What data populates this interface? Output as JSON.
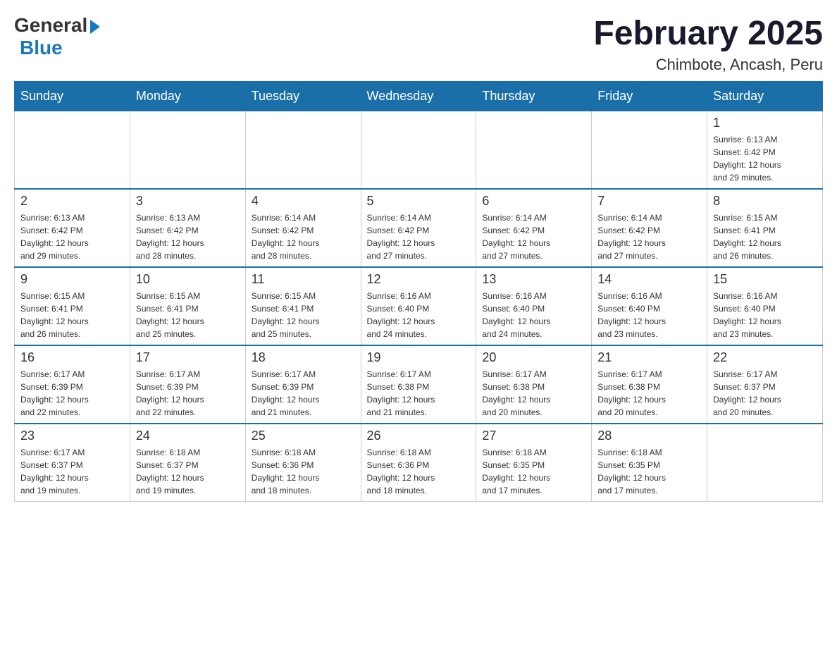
{
  "header": {
    "logo": {
      "general": "General",
      "blue": "Blue"
    },
    "title": "February 2025",
    "subtitle": "Chimbote, Ancash, Peru"
  },
  "days_of_week": [
    "Sunday",
    "Monday",
    "Tuesday",
    "Wednesday",
    "Thursday",
    "Friday",
    "Saturday"
  ],
  "weeks": [
    [
      {
        "day": "",
        "info": ""
      },
      {
        "day": "",
        "info": ""
      },
      {
        "day": "",
        "info": ""
      },
      {
        "day": "",
        "info": ""
      },
      {
        "day": "",
        "info": ""
      },
      {
        "day": "",
        "info": ""
      },
      {
        "day": "1",
        "info": "Sunrise: 6:13 AM\nSunset: 6:42 PM\nDaylight: 12 hours\nand 29 minutes."
      }
    ],
    [
      {
        "day": "2",
        "info": "Sunrise: 6:13 AM\nSunset: 6:42 PM\nDaylight: 12 hours\nand 29 minutes."
      },
      {
        "day": "3",
        "info": "Sunrise: 6:13 AM\nSunset: 6:42 PM\nDaylight: 12 hours\nand 28 minutes."
      },
      {
        "day": "4",
        "info": "Sunrise: 6:14 AM\nSunset: 6:42 PM\nDaylight: 12 hours\nand 28 minutes."
      },
      {
        "day": "5",
        "info": "Sunrise: 6:14 AM\nSunset: 6:42 PM\nDaylight: 12 hours\nand 27 minutes."
      },
      {
        "day": "6",
        "info": "Sunrise: 6:14 AM\nSunset: 6:42 PM\nDaylight: 12 hours\nand 27 minutes."
      },
      {
        "day": "7",
        "info": "Sunrise: 6:14 AM\nSunset: 6:42 PM\nDaylight: 12 hours\nand 27 minutes."
      },
      {
        "day": "8",
        "info": "Sunrise: 6:15 AM\nSunset: 6:41 PM\nDaylight: 12 hours\nand 26 minutes."
      }
    ],
    [
      {
        "day": "9",
        "info": "Sunrise: 6:15 AM\nSunset: 6:41 PM\nDaylight: 12 hours\nand 26 minutes."
      },
      {
        "day": "10",
        "info": "Sunrise: 6:15 AM\nSunset: 6:41 PM\nDaylight: 12 hours\nand 25 minutes."
      },
      {
        "day": "11",
        "info": "Sunrise: 6:15 AM\nSunset: 6:41 PM\nDaylight: 12 hours\nand 25 minutes."
      },
      {
        "day": "12",
        "info": "Sunrise: 6:16 AM\nSunset: 6:40 PM\nDaylight: 12 hours\nand 24 minutes."
      },
      {
        "day": "13",
        "info": "Sunrise: 6:16 AM\nSunset: 6:40 PM\nDaylight: 12 hours\nand 24 minutes."
      },
      {
        "day": "14",
        "info": "Sunrise: 6:16 AM\nSunset: 6:40 PM\nDaylight: 12 hours\nand 23 minutes."
      },
      {
        "day": "15",
        "info": "Sunrise: 6:16 AM\nSunset: 6:40 PM\nDaylight: 12 hours\nand 23 minutes."
      }
    ],
    [
      {
        "day": "16",
        "info": "Sunrise: 6:17 AM\nSunset: 6:39 PM\nDaylight: 12 hours\nand 22 minutes."
      },
      {
        "day": "17",
        "info": "Sunrise: 6:17 AM\nSunset: 6:39 PM\nDaylight: 12 hours\nand 22 minutes."
      },
      {
        "day": "18",
        "info": "Sunrise: 6:17 AM\nSunset: 6:39 PM\nDaylight: 12 hours\nand 21 minutes."
      },
      {
        "day": "19",
        "info": "Sunrise: 6:17 AM\nSunset: 6:38 PM\nDaylight: 12 hours\nand 21 minutes."
      },
      {
        "day": "20",
        "info": "Sunrise: 6:17 AM\nSunset: 6:38 PM\nDaylight: 12 hours\nand 20 minutes."
      },
      {
        "day": "21",
        "info": "Sunrise: 6:17 AM\nSunset: 6:38 PM\nDaylight: 12 hours\nand 20 minutes."
      },
      {
        "day": "22",
        "info": "Sunrise: 6:17 AM\nSunset: 6:37 PM\nDaylight: 12 hours\nand 20 minutes."
      }
    ],
    [
      {
        "day": "23",
        "info": "Sunrise: 6:17 AM\nSunset: 6:37 PM\nDaylight: 12 hours\nand 19 minutes."
      },
      {
        "day": "24",
        "info": "Sunrise: 6:18 AM\nSunset: 6:37 PM\nDaylight: 12 hours\nand 19 minutes."
      },
      {
        "day": "25",
        "info": "Sunrise: 6:18 AM\nSunset: 6:36 PM\nDaylight: 12 hours\nand 18 minutes."
      },
      {
        "day": "26",
        "info": "Sunrise: 6:18 AM\nSunset: 6:36 PM\nDaylight: 12 hours\nand 18 minutes."
      },
      {
        "day": "27",
        "info": "Sunrise: 6:18 AM\nSunset: 6:35 PM\nDaylight: 12 hours\nand 17 minutes."
      },
      {
        "day": "28",
        "info": "Sunrise: 6:18 AM\nSunset: 6:35 PM\nDaylight: 12 hours\nand 17 minutes."
      },
      {
        "day": "",
        "info": ""
      }
    ]
  ]
}
